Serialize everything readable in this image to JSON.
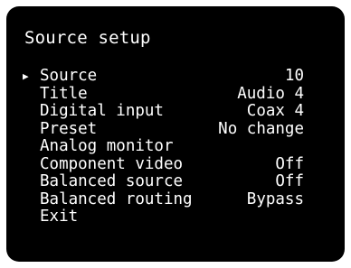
{
  "screen": {
    "title": "Source setup",
    "selection_marker": "▶",
    "menu": [
      {
        "label": "Source",
        "value": "10"
      },
      {
        "label": "Title",
        "value": "Audio 4"
      },
      {
        "label": "Digital input",
        "value": "Coax 4"
      },
      {
        "label": "Preset",
        "value": "No change"
      },
      {
        "label": "Analog monitor",
        "value": ""
      },
      {
        "label": "Component video",
        "value": "Off"
      },
      {
        "label": "Balanced source",
        "value": "Off"
      },
      {
        "label": "Balanced routing",
        "value": "Bypass"
      },
      {
        "label": "Exit",
        "value": ""
      }
    ]
  },
  "colors": {
    "background": "#000000",
    "text": "#ffffff"
  }
}
